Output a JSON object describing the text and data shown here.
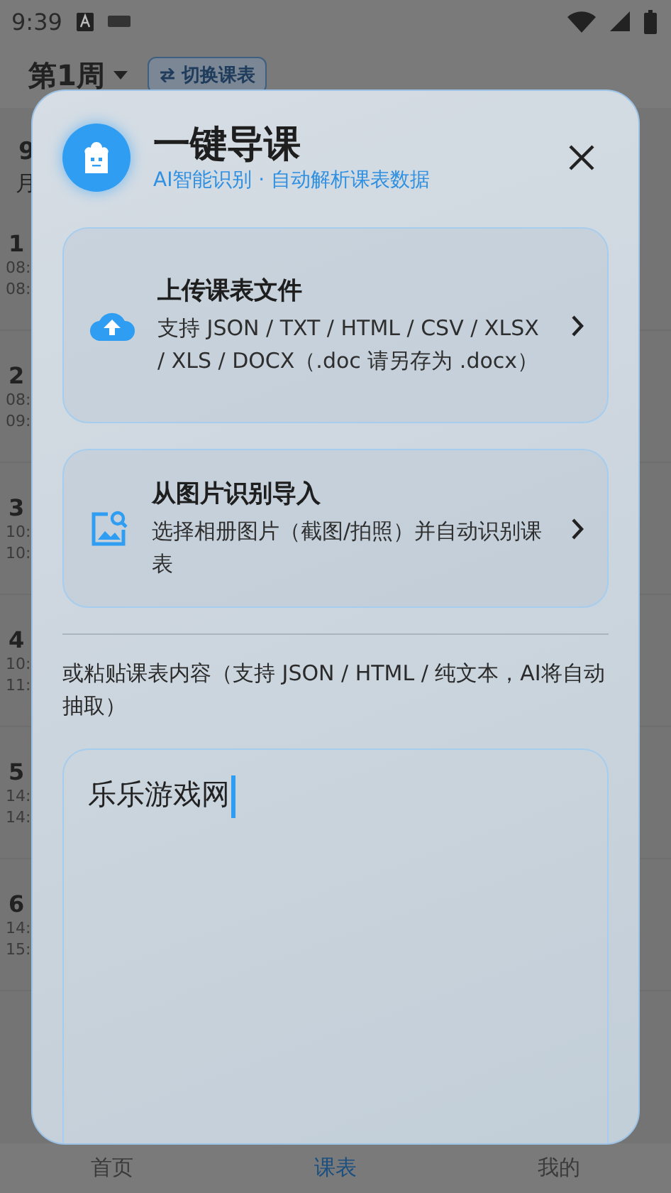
{
  "status_bar": {
    "time": "9:39"
  },
  "header": {
    "week": "第1周",
    "switch_button": "切换课表"
  },
  "schedule_column": {
    "month_number": "9",
    "month_label": "月",
    "periods": [
      {
        "number": "1",
        "start": "08:",
        "end": "08:"
      },
      {
        "number": "2",
        "start": "08:",
        "end": "09:"
      },
      {
        "number": "3",
        "start": "10:",
        "end": "10:"
      },
      {
        "number": "4",
        "start": "10:",
        "end": "11:"
      },
      {
        "number": "5",
        "start": "14:",
        "end": "14:"
      },
      {
        "number": "6",
        "start": "14:",
        "end": "15:"
      }
    ]
  },
  "dialog": {
    "title": "一键导课",
    "subtitle": "AI智能识别 · 自动解析课表数据",
    "options": [
      {
        "kind": "upload",
        "title": "上传课表文件",
        "description": "支持 JSON / TXT / HTML / CSV / XLSX / XLS / DOCX（.doc 请另存为 .docx）"
      },
      {
        "kind": "image",
        "title": "从图片识别导入",
        "description": "选择相册图片（截图/拍照）并自动识别课表"
      }
    ],
    "paste_label": "或粘贴课表内容（支持 JSON / HTML / 纯文本，AI将自动抽取）",
    "paste_field": {
      "value": "乐乐游戏网"
    }
  },
  "bottom_nav": [
    {
      "label": "首页",
      "selected": false
    },
    {
      "label": "课表",
      "selected": true
    },
    {
      "label": "我的",
      "selected": false
    }
  ]
}
